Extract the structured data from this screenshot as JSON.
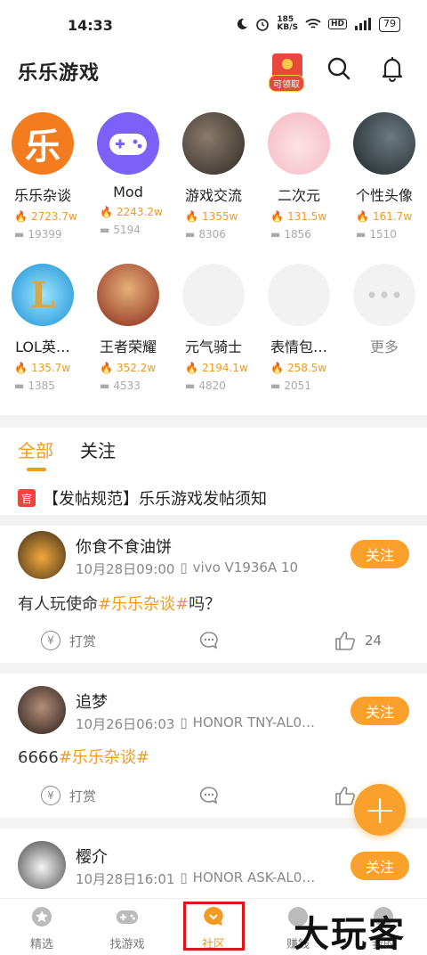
{
  "status": {
    "time": "14:33",
    "speed": "185\nKB/S",
    "battery": "79"
  },
  "header": {
    "title": "乐乐游戏",
    "redpack_label": "可领取"
  },
  "categories": [
    {
      "name": "乐乐杂谈",
      "heat": "2723.7w",
      "comments": "19399"
    },
    {
      "name": "Mod",
      "heat": "2243.2w",
      "comments": "5194"
    },
    {
      "name": "游戏交流",
      "heat": "1355w",
      "comments": "8306"
    },
    {
      "name": "二次元",
      "heat": "131.5w",
      "comments": "1856"
    },
    {
      "name": "个性头像",
      "heat": "161.7w",
      "comments": "1510"
    },
    {
      "name": "LOL英…",
      "heat": "135.7w",
      "comments": "1385"
    },
    {
      "name": "王者荣耀",
      "heat": "352.2w",
      "comments": "4533"
    },
    {
      "name": "元气骑士",
      "heat": "2194.1w",
      "comments": "4820"
    },
    {
      "name": "表情包…",
      "heat": "258.5w",
      "comments": "2051"
    },
    {
      "name": "更多"
    }
  ],
  "logo_char": "乐",
  "tabs": {
    "all": "全部",
    "follow": "关注"
  },
  "notice": {
    "badge": "官",
    "text": "【发帖规范】乐乐游戏发帖须知"
  },
  "posts": [
    {
      "user": "你食不食油饼",
      "date": "10月28日09:00",
      "device": "vivo V1936A 10",
      "follow": "关注",
      "body_pre": "有人玩使命",
      "hashtag": "#乐乐杂谈#",
      "body_post": "吗？",
      "reward": "打赏",
      "likes": "24"
    },
    {
      "user": "追梦",
      "date": "10月26日06:03",
      "device": "HONOR TNY-AL0…",
      "follow": "关注",
      "body_pre": "6666",
      "hashtag": "#乐乐杂谈#",
      "body_post": "",
      "reward": "打赏",
      "likes": ""
    },
    {
      "user": "樱介",
      "date": "10月28日16:01",
      "device": "HONOR ASK-AL0…",
      "follow": "关注"
    }
  ],
  "nav": [
    {
      "label": "精选"
    },
    {
      "label": "找游戏"
    },
    {
      "label": "社区"
    },
    {
      "label": "赚钱"
    },
    {
      "label": "我的"
    }
  ],
  "watermark": "大玩客",
  "colors": {
    "accent": "#f39a21",
    "button": "#f9a12a",
    "red": "#e8473c"
  }
}
